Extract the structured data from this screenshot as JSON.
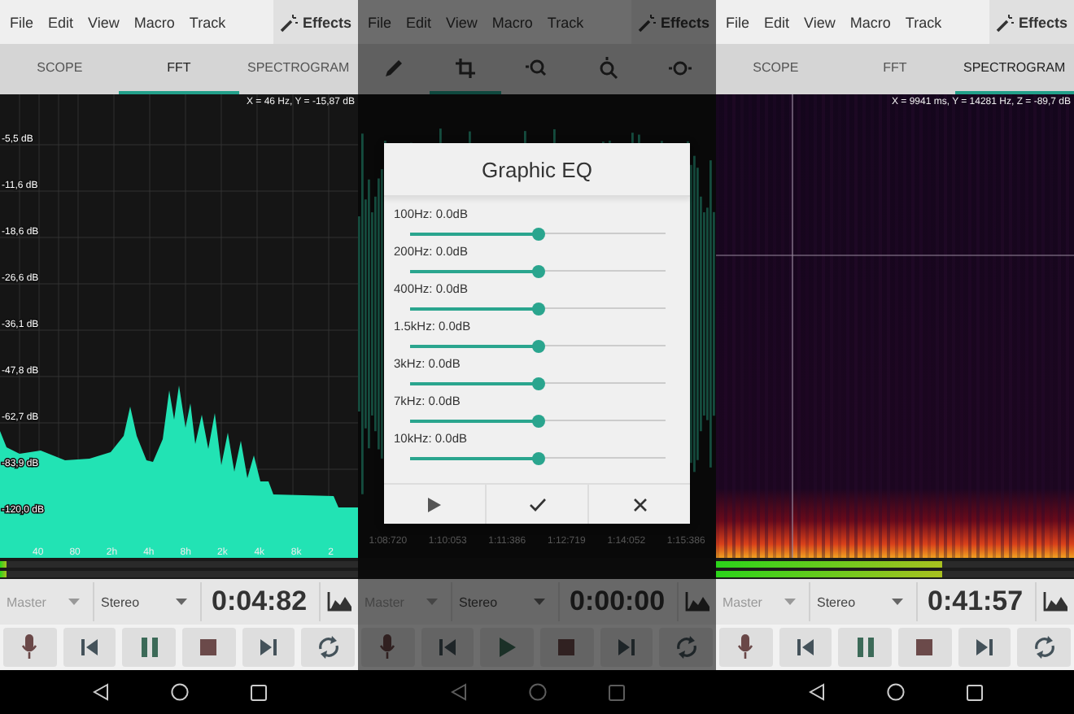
{
  "screens": [
    {
      "menu": [
        "File",
        "Edit",
        "View",
        "Macro",
        "Track"
      ],
      "effects_button": "Effects",
      "tabs": [
        {
          "kind": "text",
          "label": "SCOPE",
          "selected": false
        },
        {
          "kind": "text",
          "label": "FFT",
          "selected": true
        },
        {
          "kind": "text",
          "label": "SPECTROGRAM",
          "selected": false
        }
      ],
      "view": {
        "kind": "fft",
        "readout": "X = 46 Hz, Y = -15,87 dB",
        "y_labels": [
          "-5,5 dB",
          "-11,6 dB",
          "-18,6 dB",
          "-26,6 dB",
          "-36,1 dB",
          "-47,8 dB",
          "-62,7 dB",
          "-83,9 dB",
          "-120,0 dB"
        ],
        "x_labels": [
          "40",
          "80",
          "2h",
          "4h",
          "8h",
          "2k",
          "4k",
          "8k",
          "2"
        ]
      },
      "meters": [
        {
          "level": 0.02
        },
        {
          "level": 0.02
        }
      ],
      "channel_select": "Master",
      "mode_select": "Stereo",
      "time": "0:04:82",
      "playing": true
    },
    {
      "menu": [
        "File",
        "Edit",
        "View",
        "Macro",
        "Track"
      ],
      "effects_button": "Effects",
      "tabs": [
        {
          "kind": "pencil",
          "selected": false
        },
        {
          "kind": "select",
          "selected": true
        },
        {
          "kind": "zoom-horizontal",
          "selected": false
        },
        {
          "kind": "zoom-vertical",
          "selected": false
        },
        {
          "kind": "zoom-fit",
          "selected": false
        }
      ],
      "view": {
        "kind": "waveform",
        "time_labels": [
          "1:08:720",
          "1:10:053",
          "1:11:386",
          "1:12:719",
          "1:14:052",
          "1:15:386"
        ]
      },
      "dialog": {
        "title": "Graphic EQ",
        "bands": [
          {
            "label": "100Hz: 0.0dB",
            "level": 0.5
          },
          {
            "label": "200Hz: 0.0dB",
            "level": 0.5
          },
          {
            "label": "400Hz: 0.0dB",
            "level": 0.5
          },
          {
            "label": "1.5kHz: 0.0dB",
            "level": 0.5
          },
          {
            "label": "3kHz: 0.0dB",
            "level": 0.5
          },
          {
            "label": "7kHz: 0.0dB",
            "level": 0.5
          },
          {
            "label": "10kHz: 0.0dB",
            "level": 0.5
          }
        ]
      },
      "channel_select": "Master",
      "mode_select": "Stereo",
      "time": "0:00:00",
      "playing": false
    },
    {
      "menu": [
        "File",
        "Edit",
        "View",
        "Macro",
        "Track"
      ],
      "effects_button": "Effects",
      "tabs": [
        {
          "kind": "text",
          "label": "SCOPE",
          "selected": false
        },
        {
          "kind": "text",
          "label": "FFT",
          "selected": false
        },
        {
          "kind": "text",
          "label": "SPECTROGRAM",
          "selected": true
        }
      ],
      "view": {
        "kind": "spectrogram",
        "readout": "X = 9941 ms, Y = 14281 Hz, Z = -89,7 dB"
      },
      "meters": [
        {
          "level": 0.63
        },
        {
          "level": 0.63
        }
      ],
      "channel_select": "Master",
      "mode_select": "Stereo",
      "time": "0:41:57",
      "playing": true
    }
  ]
}
